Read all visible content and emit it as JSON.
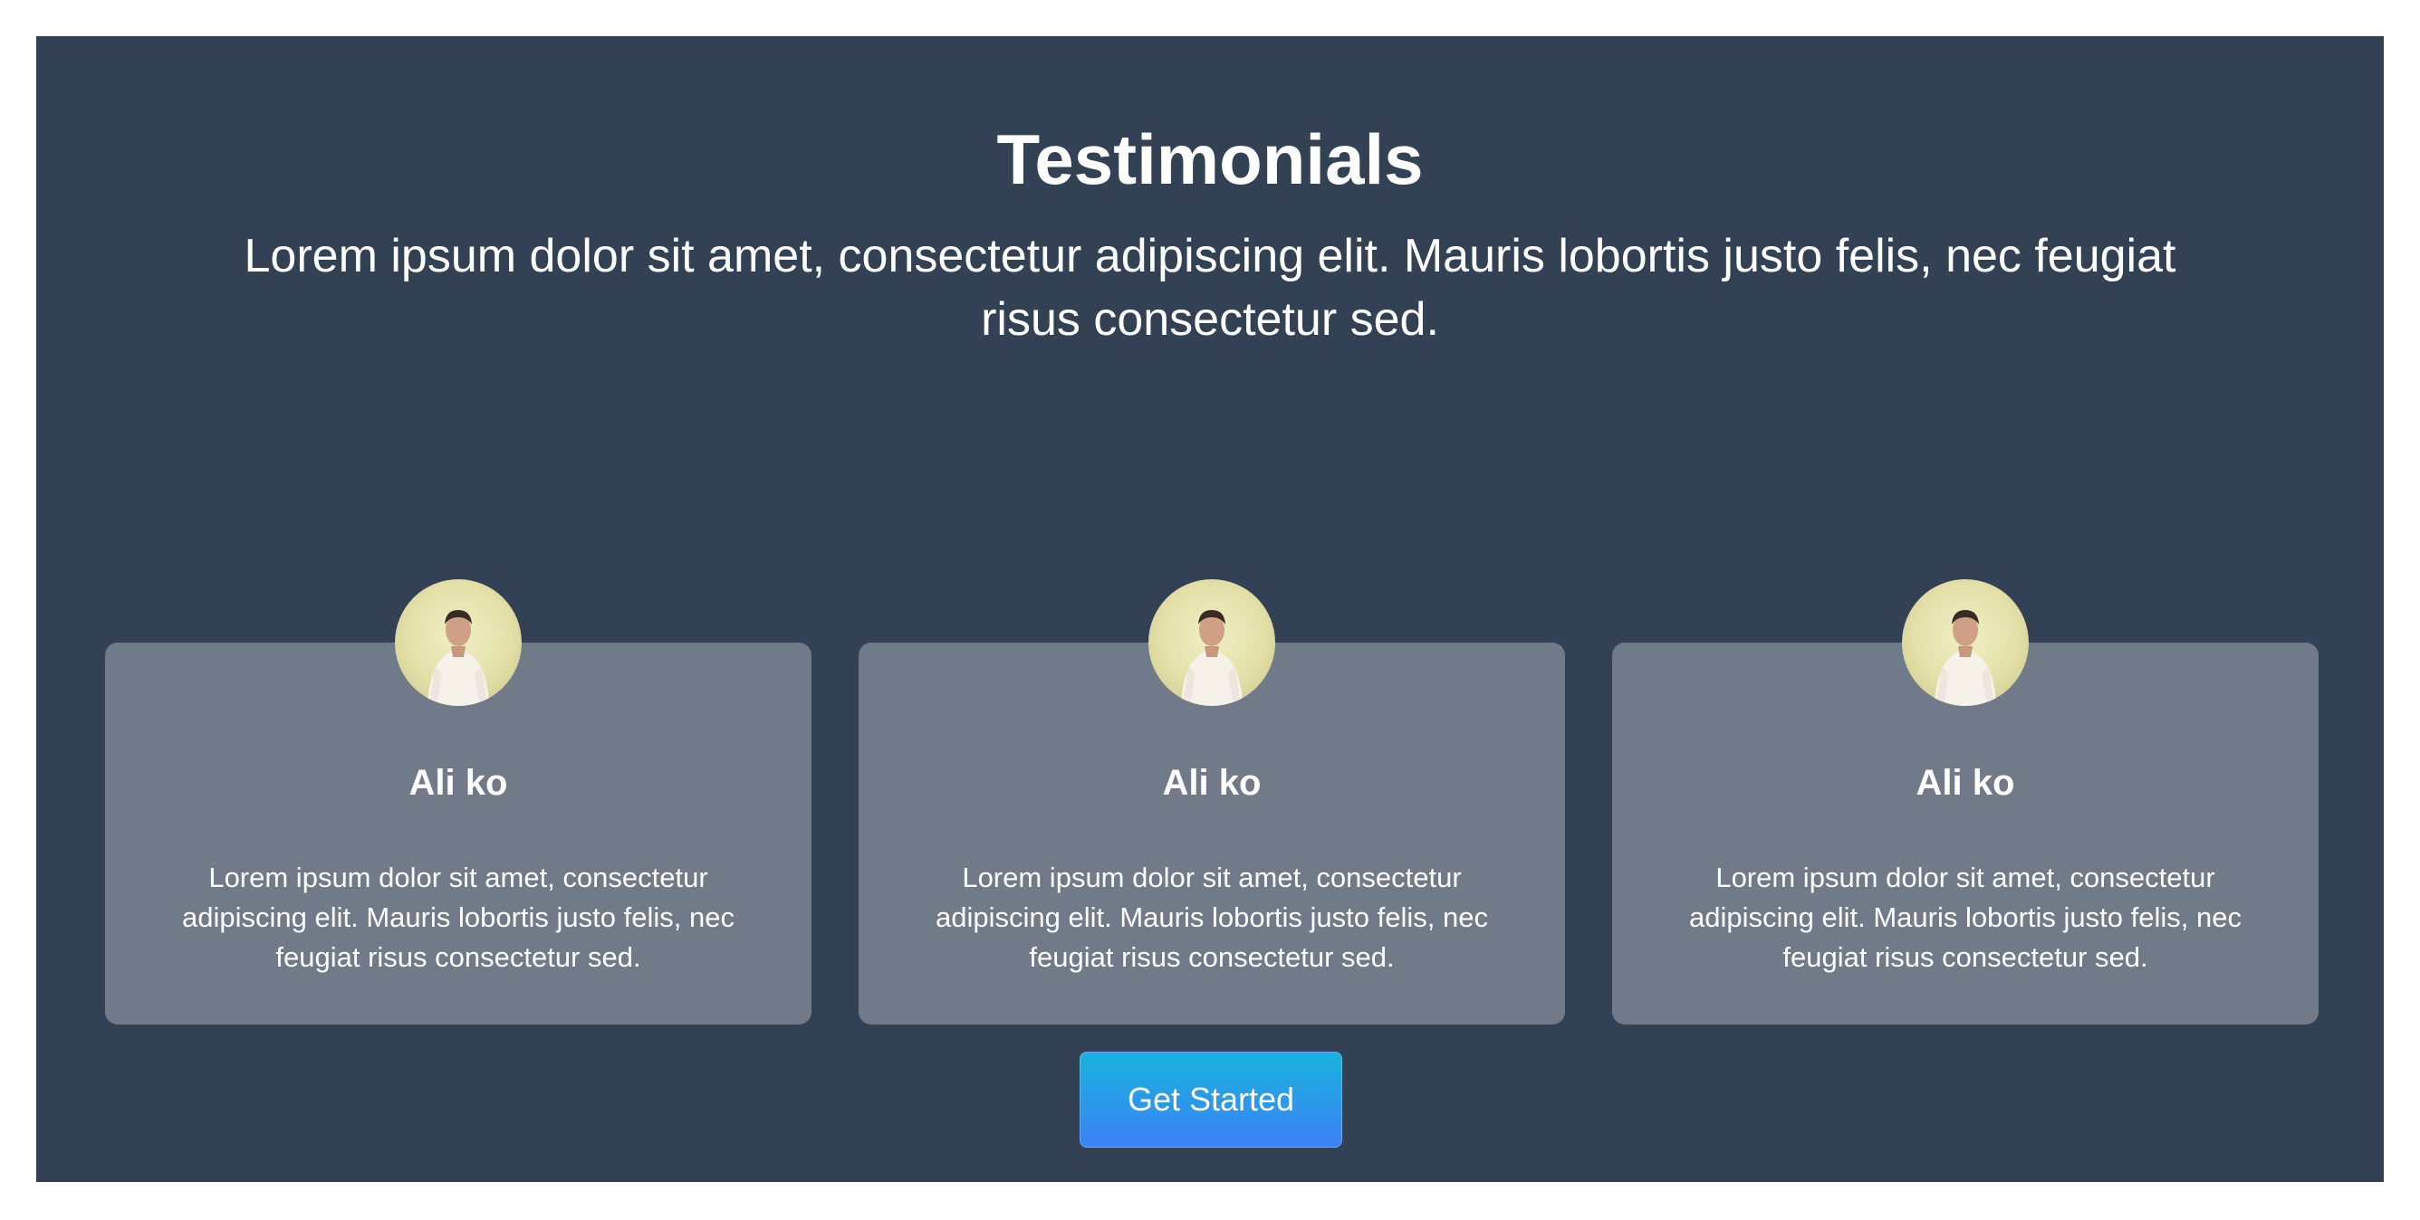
{
  "header": {
    "title": "Testimonials",
    "subtitle": "Lorem ipsum dolor sit amet, consectetur adipiscing elit. Mauris lobortis justo felis, nec feugiat risus consectetur sed."
  },
  "testimonials": [
    {
      "name": "Ali ko",
      "text": "Lorem ipsum dolor sit amet, consectetur adipiscing elit. Mauris lobortis justo felis, nec feugiat risus consectetur sed."
    },
    {
      "name": "Ali ko",
      "text": "Lorem ipsum dolor sit amet, consectetur adipiscing elit. Mauris lobortis justo felis, nec feugiat risus consectetur sed."
    },
    {
      "name": "Ali ko",
      "text": "Lorem ipsum dolor sit amet, consectetur adipiscing elit. Mauris lobortis justo felis, nec feugiat risus consectetur sed."
    }
  ],
  "cta": {
    "label": "Get Started"
  },
  "colors": {
    "section_background": "#334155",
    "card_background": "#717a89",
    "button_gradient_start": "#18b3dc",
    "button_gradient_end": "#3b82f6",
    "text": "#ffffff"
  },
  "icons": {
    "avatar": "person-avatar-icon"
  }
}
